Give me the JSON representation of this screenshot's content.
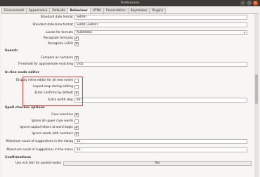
{
  "window": {
    "title": "Preferences",
    "minimize": "–",
    "maximize": "□",
    "close": "×"
  },
  "tabs": [
    "Environment",
    "Appearance",
    "Defaults",
    "Behaviour",
    "HTML",
    "Presentation",
    "Keystrokes",
    "Plugins"
  ],
  "active_tab": "Behaviour",
  "formats": {
    "date_label": "Standard date format",
    "date_value": "SHORT",
    "datetime_label": "Standard date-time format",
    "datetime_value": "SHORT,SHORT",
    "locale_label": "Locale for formats",
    "locale_value": "Automatic",
    "recognize_formulas_label": "Recognize formulas",
    "recognize_formulas_checked": true,
    "recognize_latex_label": "Recognize LaTeX",
    "recognize_latex_checked": true
  },
  "search": {
    "heading": "Search",
    "compare_label": "Compare as numbers",
    "compare_checked": true,
    "threshold_label": "Threshold for approximate matching",
    "threshold_value": "0.65"
  },
  "inline_editor": {
    "heading": "In-line node editor",
    "display_label": "Display inline editor for all new nodes",
    "display_checked": false,
    "layout_label": "Layout map during editing",
    "layout_checked": false,
    "enter_label": "Enter confirms by default",
    "enter_checked": true,
    "extra_width_label": "Extra width step",
    "extra_width_value": "80"
  },
  "spell": {
    "heading": "Spell checker options",
    "case_label": "Case sensitive",
    "case_checked": true,
    "upper_label": "Ignore all upper case words",
    "upper_checked": false,
    "capital_label": "Ignore capital letters at word begin",
    "capital_checked": true,
    "numbers_label": "Ignore words with numbers",
    "numbers_checked": true,
    "max_dialog_label": "Maximum count of suggestions in the dialog",
    "max_dialog_value": "15",
    "max_menu_label": "Maximum count of suggestions in the menu",
    "max_menu_value": "15"
  },
  "confirmations": {
    "heading": "Confirmations",
    "rich_text_label": "Use rich text for pasted nodes",
    "rich_text_value": "Yes"
  },
  "icons": {
    "checkmark": "✔",
    "dropdown": "▾"
  }
}
